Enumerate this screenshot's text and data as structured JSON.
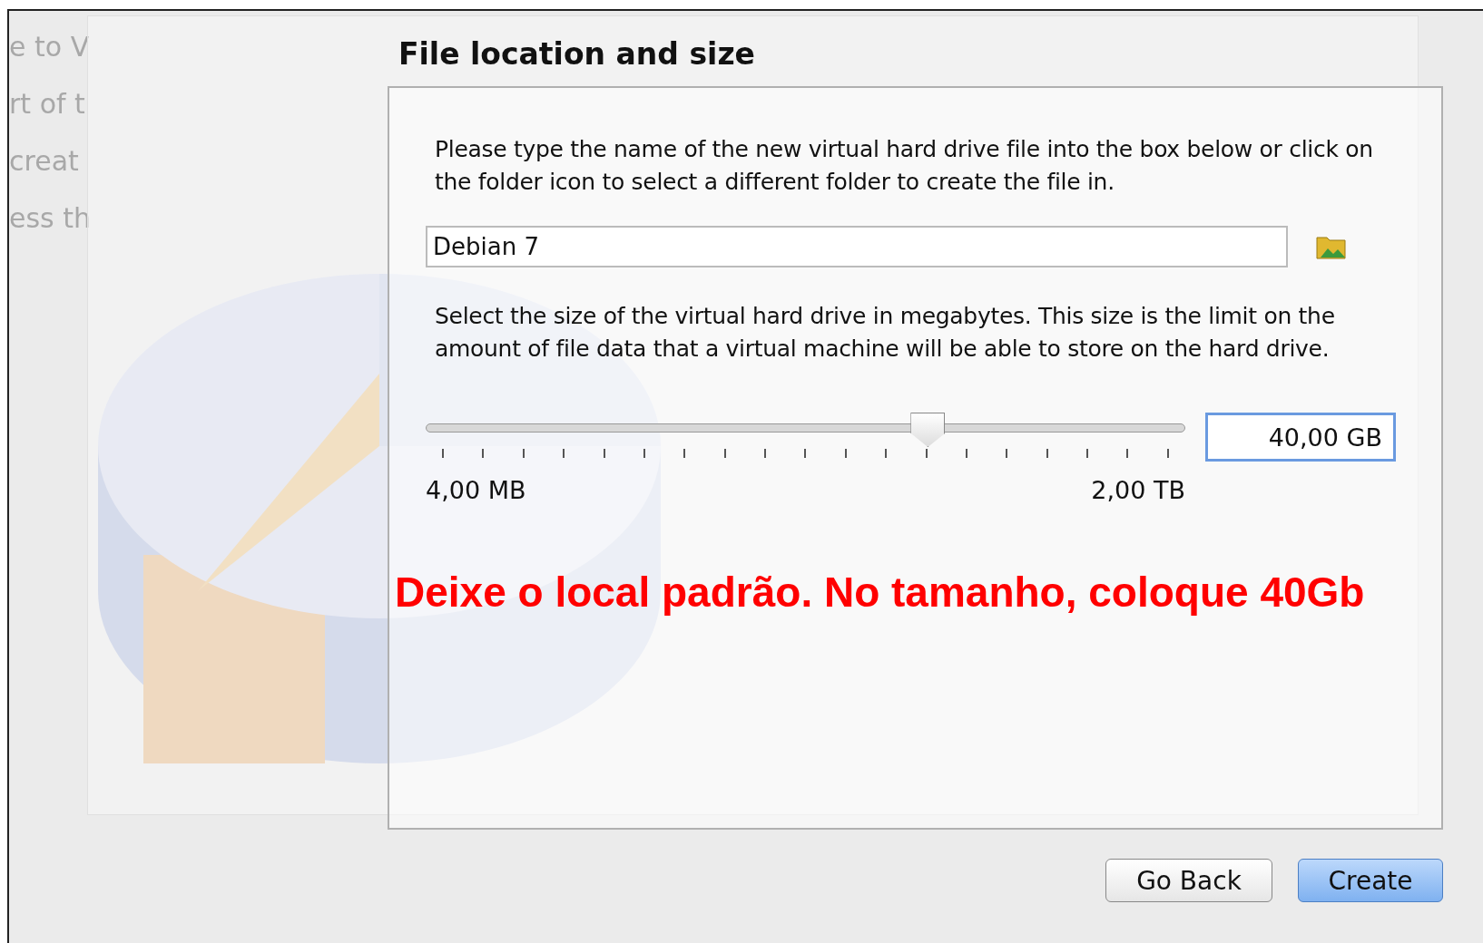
{
  "background_dialog": {
    "side_fragments": [
      "e to V",
      "rt of t",
      "creat",
      "ess th"
    ]
  },
  "title": "File location and size",
  "location": {
    "text": "Please type the name of the new virtual hard drive file into the box below or click on the folder icon to select a different folder to create the file in.",
    "value": "Debian 7"
  },
  "size": {
    "text": "Select the size of the virtual hard drive in megabytes. This size is the limit on the amount of file data that a virtual machine will be able to store on the hard drive.",
    "level": 0.66,
    "value": "40,00 GB",
    "min_label": "4,00 MB",
    "max_label": "2,00 TB"
  },
  "annotation": "Deixe o local padrão. No tamanho, coloque 40Gb",
  "buttons": [
    {
      "label": "Go Back",
      "kind": "normal"
    },
    {
      "label": "Create",
      "kind": "default"
    }
  ]
}
